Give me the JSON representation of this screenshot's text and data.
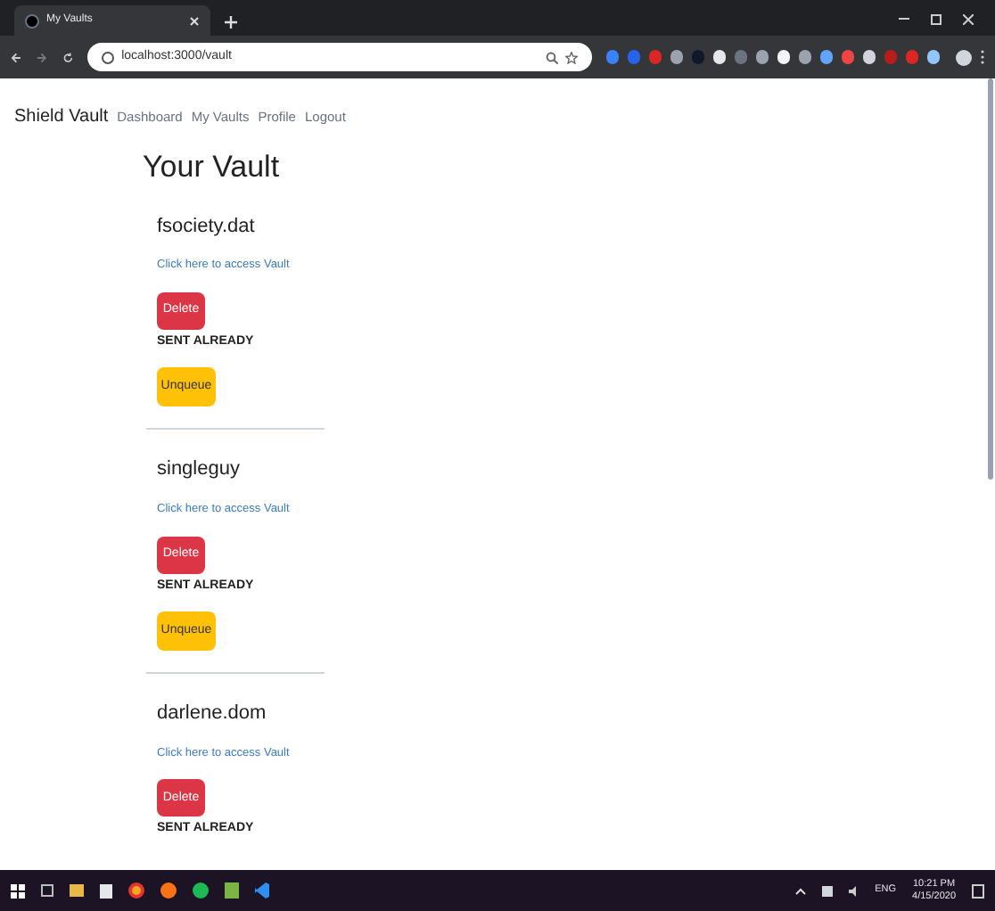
{
  "browser": {
    "tab_title": "My Vaults",
    "url": "localhost:3000/vault"
  },
  "nav": {
    "brand": "Shield Vault",
    "links": [
      "Dashboard",
      "My Vaults",
      "Profile",
      "Logout"
    ]
  },
  "heading": "Your Vault",
  "vaults": [
    {
      "name": "fsociety.dat",
      "link": "Click here to access Vault",
      "delete": "Delete",
      "status": "SENT ALREADY",
      "unqueue": "Unqueue"
    },
    {
      "name": "singleguy",
      "link": "Click here to access Vault",
      "delete": "Delete",
      "status": "SENT ALREADY",
      "unqueue": "Unqueue"
    },
    {
      "name": "darlene.dom",
      "link": "Click here to access Vault",
      "delete": "Delete",
      "status": "SENT ALREADY"
    }
  ],
  "taskbar": {
    "lang": "ENG",
    "time": "10:21 PM",
    "date": "4/15/2020"
  }
}
